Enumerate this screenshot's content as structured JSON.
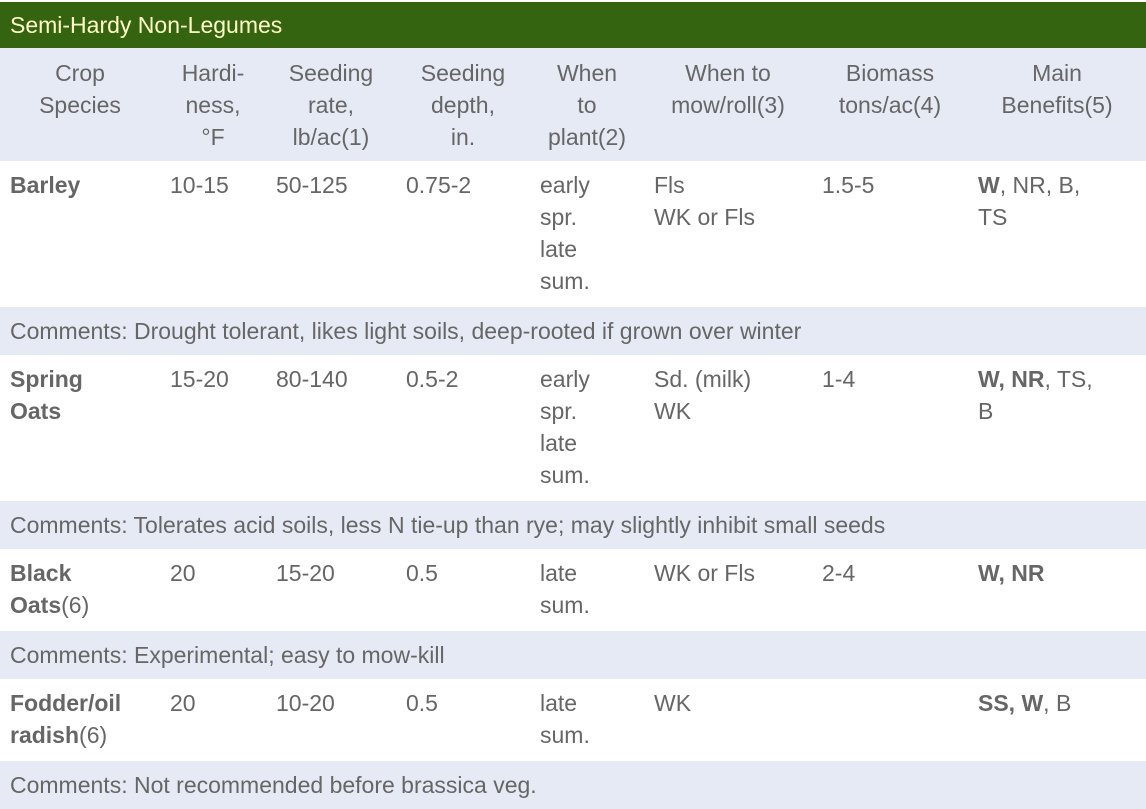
{
  "title": "Semi-Hardy Non-Legumes",
  "colors": {
    "title_bg": "#356410",
    "title_text": "#ffffc8",
    "header_bg": "#e5eaf5",
    "comment_bg": "#e5eaf5",
    "row_bg": "#ffffff",
    "text": "#666666"
  },
  "headers": [
    {
      "lines": [
        "Crop",
        "Species"
      ]
    },
    {
      "lines": [
        "Hardi-",
        "ness,",
        "°F"
      ]
    },
    {
      "lines": [
        "Seeding",
        "rate,",
        "lb/ac(1)"
      ]
    },
    {
      "lines": [
        "Seeding",
        "depth,",
        "in."
      ]
    },
    {
      "lines": [
        "When",
        "to",
        "plant(2)"
      ]
    },
    {
      "lines": [
        "When to",
        "mow/roll(3)"
      ]
    },
    {
      "lines": [
        "Biomass",
        "tons/ac(4)"
      ]
    },
    {
      "lines": [
        "Main",
        "Benefits(5)"
      ]
    }
  ],
  "rows": [
    {
      "crop": {
        "lines": [
          {
            "bold": "Barley",
            "normal": ""
          }
        ]
      },
      "hardiness": "10-15",
      "seeding_rate": "50-125",
      "seeding_depth": "0.75-2",
      "when_to_plant": [
        "early",
        "spr.",
        "late",
        "sum."
      ],
      "when_to_mow": [
        "Fls",
        "WK or Fls"
      ],
      "biomass": "1.5-5",
      "benefits": {
        "lines": [
          [
            {
              "t": "W",
              "b": true
            },
            {
              "t": ", NR, B,",
              "b": false
            }
          ],
          [
            {
              "t": "TS",
              "b": false
            }
          ]
        ]
      },
      "comment": "Comments: Drought tolerant, likes light soils, deep-rooted if grown over winter"
    },
    {
      "crop": {
        "lines": [
          {
            "bold": "Spring",
            "normal": ""
          },
          {
            "bold": "Oats",
            "normal": ""
          }
        ]
      },
      "hardiness": "15-20",
      "seeding_rate": "80-140",
      "seeding_depth": "0.5-2",
      "when_to_plant": [
        "early",
        "spr.",
        "late",
        "sum."
      ],
      "when_to_mow": [
        "Sd. (milk)",
        "WK"
      ],
      "biomass": "1-4",
      "benefits": {
        "lines": [
          [
            {
              "t": "W, NR",
              "b": true
            },
            {
              "t": ", TS,",
              "b": false
            }
          ],
          [
            {
              "t": "B",
              "b": false
            }
          ]
        ]
      },
      "comment": "Comments: Tolerates acid soils, less N tie-up than rye; may slightly inhibit small seeds"
    },
    {
      "crop": {
        "lines": [
          {
            "bold": "Black",
            "normal": ""
          },
          {
            "bold": "Oats",
            "normal": "(6)"
          }
        ]
      },
      "hardiness": "20",
      "seeding_rate": "15-20",
      "seeding_depth": "0.5",
      "when_to_plant": [
        "late",
        "sum."
      ],
      "when_to_mow": [
        "WK or Fls"
      ],
      "biomass": "2-4",
      "benefits": {
        "lines": [
          [
            {
              "t": "W, NR",
              "b": true
            }
          ]
        ]
      },
      "comment": "Comments: Experimental; easy to mow-kill"
    },
    {
      "crop": {
        "lines": [
          {
            "bold": "Fodder/oil",
            "normal": ""
          },
          {
            "bold": "radish",
            "normal": "(6)"
          }
        ]
      },
      "hardiness": "20",
      "seeding_rate": "10-20",
      "seeding_depth": "0.5",
      "when_to_plant": [
        "late",
        "sum."
      ],
      "when_to_mow": [
        "WK"
      ],
      "biomass": "",
      "benefits": {
        "lines": [
          [
            {
              "t": "SS, W",
              "b": true
            },
            {
              "t": ", B",
              "b": false
            }
          ]
        ]
      },
      "comment": "Comments: Not recommended before brassica veg."
    }
  ]
}
